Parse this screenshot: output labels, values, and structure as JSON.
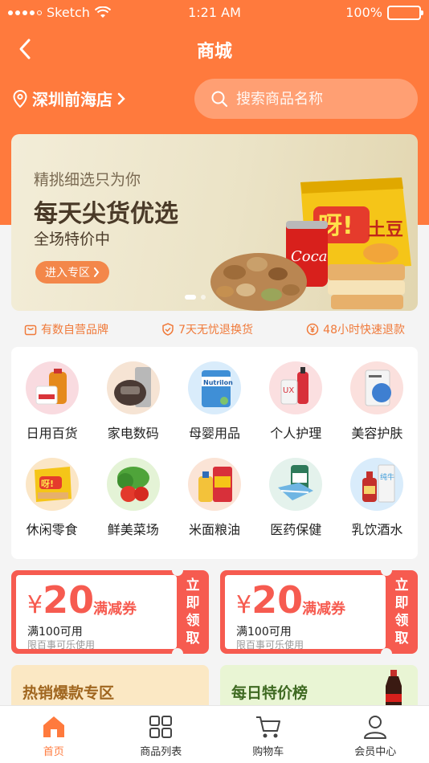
{
  "status_bar": {
    "carrier": "Sketch",
    "time": "1:21 AM",
    "battery": "100%"
  },
  "nav": {
    "title": "商城"
  },
  "store": {
    "name": "深圳前海店"
  },
  "search": {
    "placeholder": "搜索商品名称"
  },
  "banner": {
    "subtitle": "精挑细选只为你",
    "title": "每天尖货优选",
    "desc": "全场特价中",
    "cta": "进入专区",
    "slides": 3,
    "active_slide": 1
  },
  "guarantees": [
    {
      "icon": "bag-icon",
      "label": "有数自营品牌"
    },
    {
      "icon": "shield-icon",
      "label": "7天无忧退换货"
    },
    {
      "icon": "yen-circle-icon",
      "label": "48小时快速退款"
    }
  ],
  "categories": [
    {
      "label": "日用百货",
      "icon": "daily-goods-icon"
    },
    {
      "label": "家电数码",
      "icon": "appliance-icon"
    },
    {
      "label": "母婴用品",
      "icon": "baby-formula-icon"
    },
    {
      "label": "个人护理",
      "icon": "personal-care-icon"
    },
    {
      "label": "美容护肤",
      "icon": "skincare-icon"
    },
    {
      "label": "休闲零食",
      "icon": "snacks-icon"
    },
    {
      "label": "鲜美菜场",
      "icon": "vegetables-icon"
    },
    {
      "label": "米面粮油",
      "icon": "grain-oil-icon"
    },
    {
      "label": "医药保健",
      "icon": "medicine-icon"
    },
    {
      "label": "乳饮酒水",
      "icon": "drinks-icon"
    }
  ],
  "coupons": [
    {
      "yen": "¥",
      "amount": "20",
      "type": "满减券",
      "condition": "满100可用",
      "scope": "限百事可乐使用",
      "claim": [
        "立",
        "即",
        "领",
        "取"
      ]
    },
    {
      "yen": "¥",
      "amount": "20",
      "type": "满减券",
      "condition": "满100可用",
      "scope": "限百事可乐使用",
      "claim": [
        "立",
        "即",
        "领",
        "取"
      ]
    }
  ],
  "promos": [
    {
      "title": "热销爆款专区"
    },
    {
      "title": "每日特价榜"
    }
  ],
  "tabs": [
    {
      "label": "首页",
      "icon": "home-icon",
      "active": true
    },
    {
      "label": "商品列表",
      "icon": "grid-icon",
      "active": false
    },
    {
      "label": "购物车",
      "icon": "cart-icon",
      "active": false
    },
    {
      "label": "会员中心",
      "icon": "user-icon",
      "active": false
    }
  ],
  "colors": {
    "brand": "#ff7a3d",
    "coupon": "#f65b50",
    "guarantee_text": "#f07a3a"
  }
}
